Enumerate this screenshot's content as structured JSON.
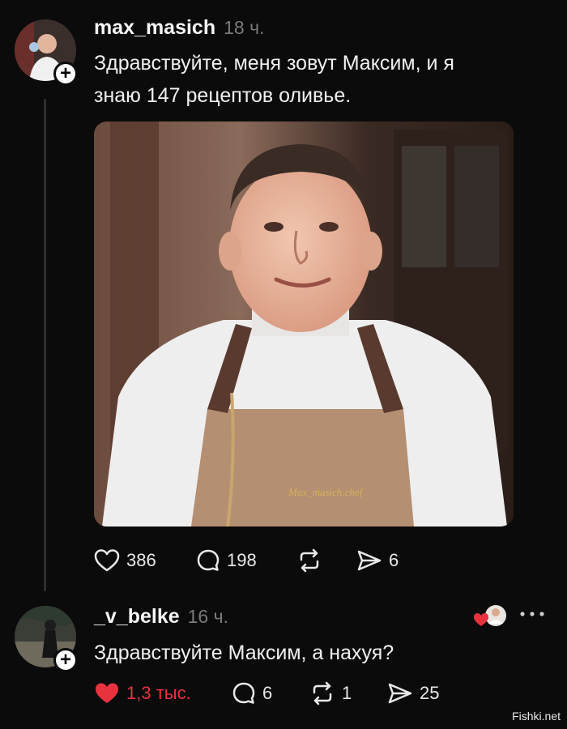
{
  "post": {
    "username": "max_masich",
    "time": "18 ч.",
    "text_line1": "Здравствуйте, меня зовут Максим, и я",
    "text_line2": "знаю 147 рецептов оливье.",
    "photo_caption": "Max_masich.chef",
    "likes": "386",
    "comments": "198",
    "shares": "6"
  },
  "reply": {
    "username": "_v_belke",
    "time": "16 ч.",
    "text": "Здравствуйте Максим, а нахуя?",
    "likes": "1,3 тыс.",
    "comments": "6",
    "reposts": "1",
    "shares": "25"
  },
  "watermark": "Fishki.net",
  "colors": {
    "background": "#0b0b0b",
    "like_red": "#e8333f",
    "muted_text": "#7a7a7a"
  },
  "icons": [
    "plus-icon",
    "heart-icon",
    "comment-icon",
    "repost-icon",
    "send-icon",
    "more-icon"
  ]
}
